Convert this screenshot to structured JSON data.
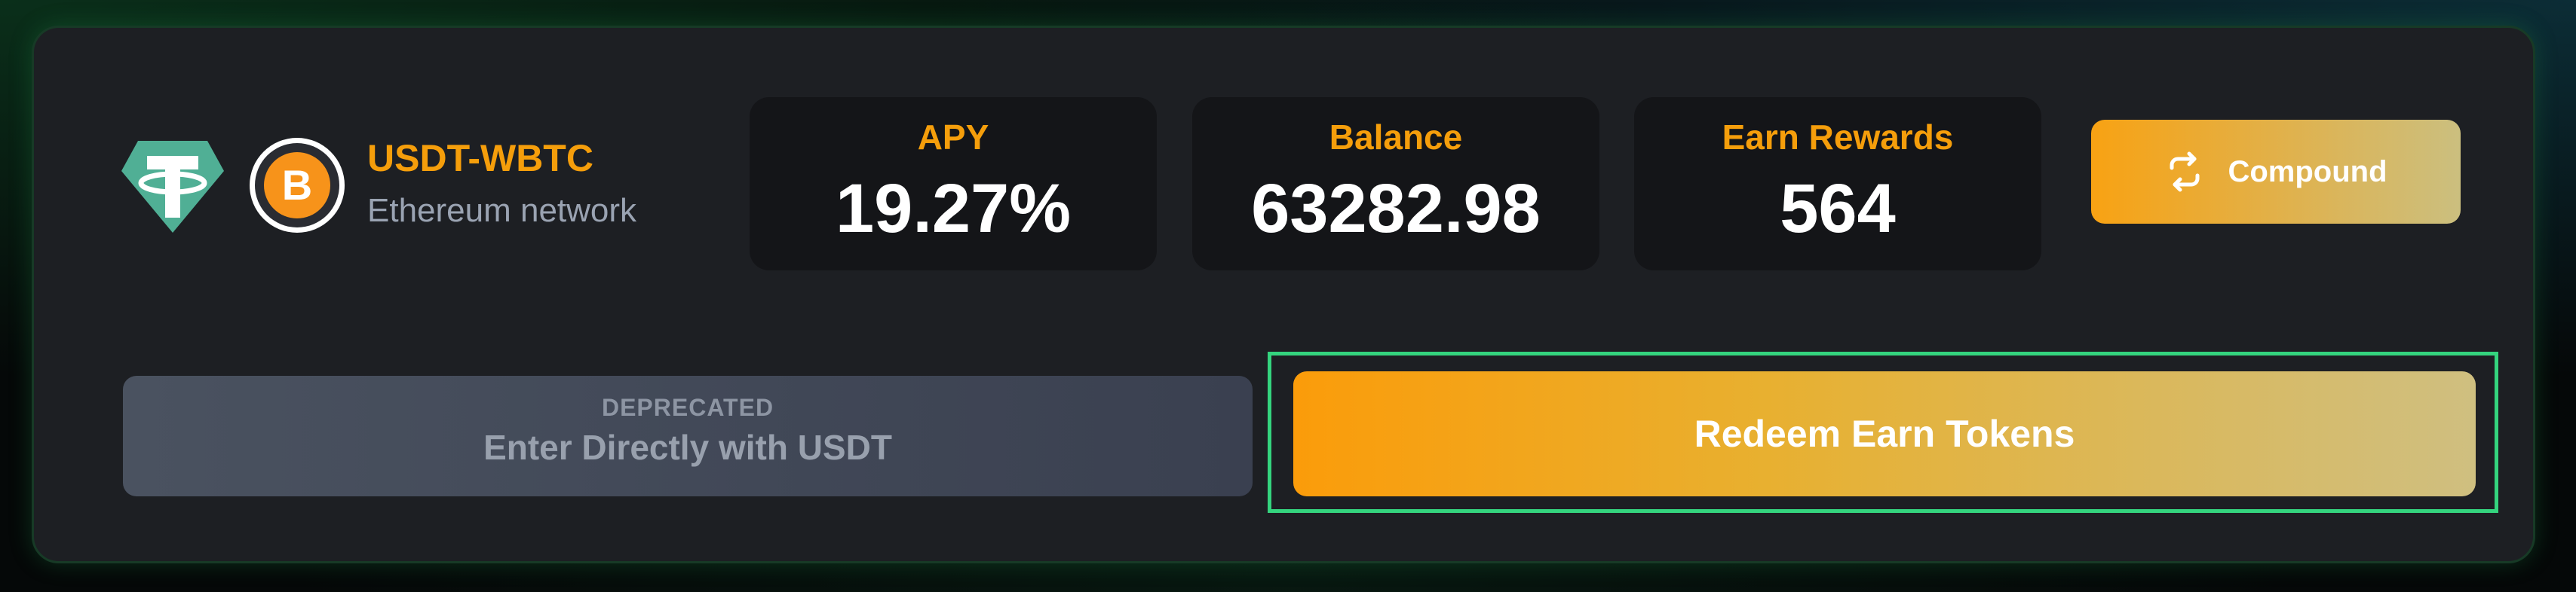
{
  "pair": {
    "name": "USDT-WBTC",
    "network": "Ethereum network",
    "tokens": [
      {
        "symbol_icon": "tether-icon",
        "color": "#50af95"
      },
      {
        "symbol_icon": "bitcoin-icon",
        "color": "#f7931a"
      }
    ]
  },
  "stats": {
    "apy": {
      "label": "APY",
      "value": "19.27%"
    },
    "balance": {
      "label": "Balance",
      "value": "63282.98"
    },
    "rewards": {
      "label": "Earn Rewards",
      "value": "564"
    }
  },
  "actions": {
    "compound_label": "Compound",
    "compound_icon": "refresh-icon",
    "deprecated_tag": "DEPRECATED",
    "deprecated_label": "Enter Directly with USDT",
    "redeem_label": "Redeem Earn Tokens"
  },
  "colors": {
    "accent": "#f59e0b",
    "card_bg": "#1d1f23",
    "stat_bg": "#141518",
    "focus_ring": "#34d47e"
  }
}
